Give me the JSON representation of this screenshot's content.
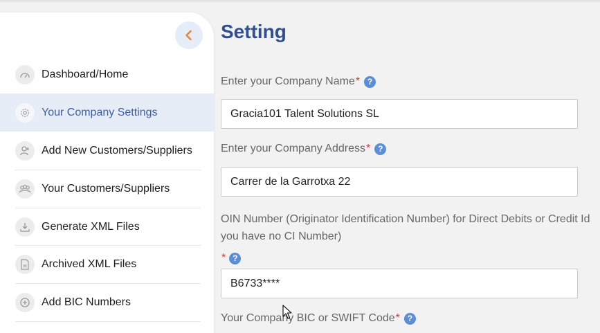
{
  "sidebar": {
    "items": [
      {
        "label": "Dashboard/Home",
        "icon": "gauge-icon"
      },
      {
        "label": "Your Company Settings",
        "icon": "gear-icon",
        "active": true
      },
      {
        "label": "Add New Customers/Suppliers",
        "icon": "user-add-icon"
      },
      {
        "label": "Your Customers/Suppliers",
        "icon": "users-icon"
      },
      {
        "label": "Generate XML Files",
        "icon": "download-icon"
      },
      {
        "label": "Archived XML Files",
        "icon": "file-icon"
      },
      {
        "label": "Add BIC Numbers",
        "icon": "plus-circle-icon"
      }
    ]
  },
  "main": {
    "title": "Setting",
    "fields": {
      "company_name": {
        "label": "Enter your Company Name",
        "required": "*",
        "value": "Gracia101 Talent Solutions SL"
      },
      "company_address": {
        "label": "Enter your Company Address",
        "required": "*",
        "value": "Carrer de la Garrotxa 22"
      },
      "oin": {
        "description_line1": "OIN Number (Originator Identification Number) for Direct Debits or Credit Id",
        "description_line2": "you have no CI Number)",
        "required": "*",
        "value": "B6733****"
      },
      "bic": {
        "label": "Your Company BIC or SWIFT Code",
        "required": "*"
      }
    },
    "help_glyph": "?"
  },
  "colors": {
    "accent": "#2f4f8f",
    "active_bg": "#e7edf6",
    "required": "#d83a3a",
    "help": "#5b8ed6",
    "collapse_chevron": "#e8863a"
  }
}
